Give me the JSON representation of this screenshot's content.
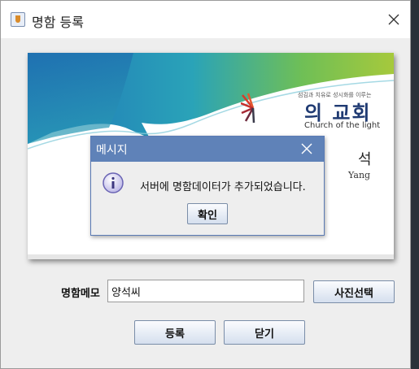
{
  "window": {
    "title": "명함 등록",
    "icon": "java-cup-icon",
    "close_icon": "close-x-icon"
  },
  "card": {
    "tagline": "섬김과 치유로 성시화를 이루는",
    "church_name_kr": "의 교회",
    "church_name_en": "Church of the light",
    "name_char": "석",
    "name_sub": "Yang"
  },
  "form": {
    "memo_label": "명함메모",
    "memo_value": "양석씨",
    "photo_button": "사진선택",
    "register_button": "등록",
    "close_button": "닫기"
  },
  "dialog": {
    "title": "메시지",
    "message": "서버에 명함데이터가 추가되었습니다.",
    "ok_button": "확인",
    "icon": "info-icon"
  },
  "colors": {
    "accent": "#5f82b8",
    "card_teal": "#2aa3b8",
    "card_green": "#9bc53d",
    "logo_navy": "#1f3a72"
  }
}
